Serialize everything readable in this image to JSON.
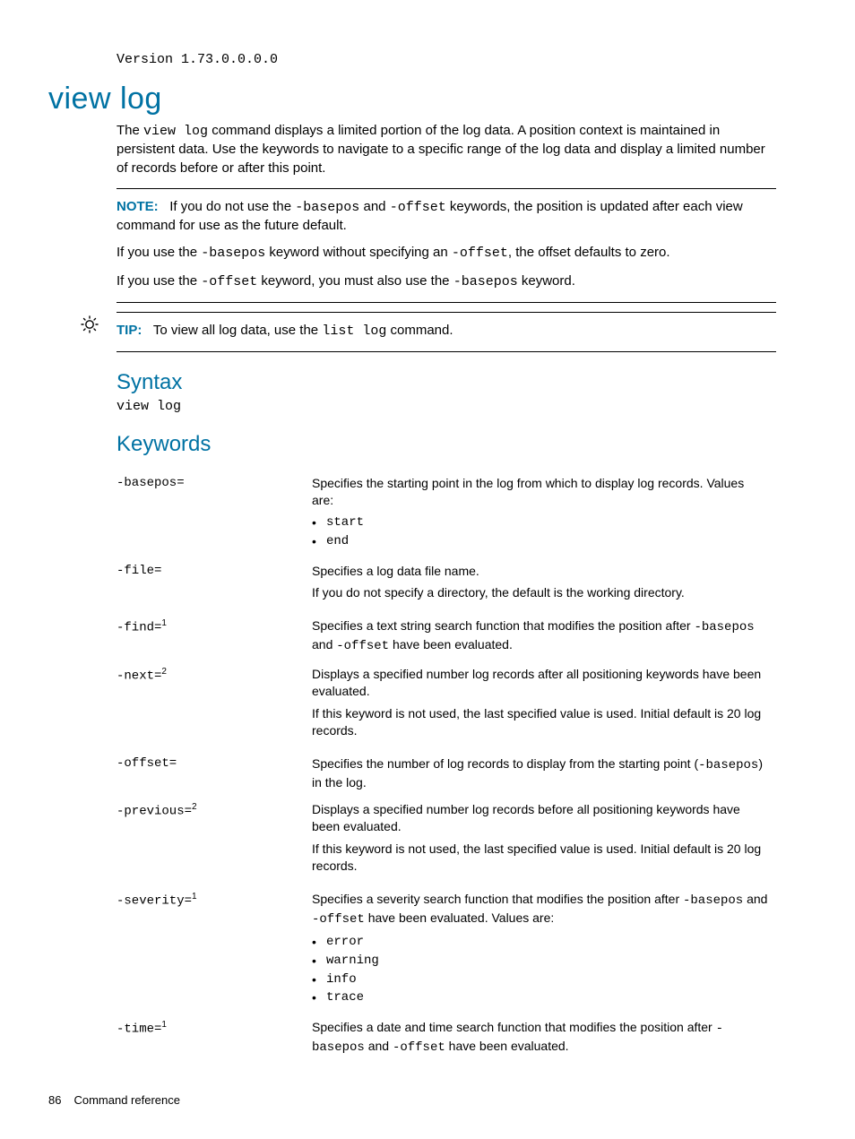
{
  "version_line": "Version 1.73.0.0.0.0",
  "heading": "view log",
  "intro": {
    "pre": "The ",
    "cmd": "view log",
    "post": " command displays a limited portion of the log data. A position context is maintained in persistent data. Use the keywords to navigate to a specific range of the log data and display a limited number of records before or after this point."
  },
  "note": {
    "label": "NOTE:",
    "p1a": "If you do not use the ",
    "c1": "-basepos",
    "p1b": " and ",
    "c2": "-offset",
    "p1c": " keywords, the position is updated after each view command for use as the future default.",
    "p2a": "If you use the ",
    "c3": "-basepos",
    "p2b": " keyword without specifying an ",
    "c4": "-offset",
    "p2c": ", the offset defaults to zero.",
    "p3a": "If you use the ",
    "c5": "-offset",
    "p3b": " keyword, you must also use the ",
    "c6": "-basepos",
    "p3c": " keyword."
  },
  "tip": {
    "label": "TIP:",
    "pre": "To view all log data, use the ",
    "cmd": "list log",
    "post": " command."
  },
  "syntax": {
    "heading": "Syntax",
    "code": "view log"
  },
  "keywords_heading": "Keywords",
  "kw": {
    "basepos": {
      "name": "-basepos=",
      "desc": "Specifies the starting point in the log from which to display log records. Values are:",
      "vals": [
        "start",
        "end"
      ]
    },
    "file": {
      "name": "-file=",
      "d1": "Specifies a log data file name.",
      "d2": "If you do not specify a directory, the default is the working directory."
    },
    "find": {
      "name": "-find=",
      "sup": "1",
      "pre": "Specifies a text string search function that modifies the position after ",
      "c1": "-basepos",
      "mid": " and ",
      "c2": "-offset",
      "post": " have been evaluated."
    },
    "next": {
      "name": "-next=",
      "sup": "2",
      "d1": "Displays a specified number log records after all positioning keywords have been evaluated.",
      "d2": "If this keyword is not used, the last specified value is used. Initial default is 20 log records."
    },
    "offset": {
      "name": "-offset=",
      "pre": "Specifies the number of log records to display from the starting point (",
      "c1": "-basepos",
      "post": ") in the log."
    },
    "previous": {
      "name": "-previous=",
      "sup": "2",
      "d1": "Displays a specified number log records before all positioning keywords have been evaluated.",
      "d2": "If this keyword is not used, the last specified value is used. Initial default is 20 log records."
    },
    "severity": {
      "name": "-severity=",
      "sup": "1",
      "pre": "Specifies a severity search function that modifies the position after ",
      "c1": "-basepos",
      "mid": " and ",
      "c2": "-offset",
      "post": " have been evaluated. Values are:",
      "vals": [
        "error",
        "warning",
        "info",
        "trace"
      ]
    },
    "time": {
      "name": "-time=",
      "sup": "1",
      "pre": "Specifies a date and time search function that modifies the position after ",
      "c1": "-basepos",
      "mid": " and ",
      "c2": "-offset",
      "post": " have been evaluated."
    }
  },
  "footer": {
    "page": "86",
    "title": "Command reference"
  }
}
